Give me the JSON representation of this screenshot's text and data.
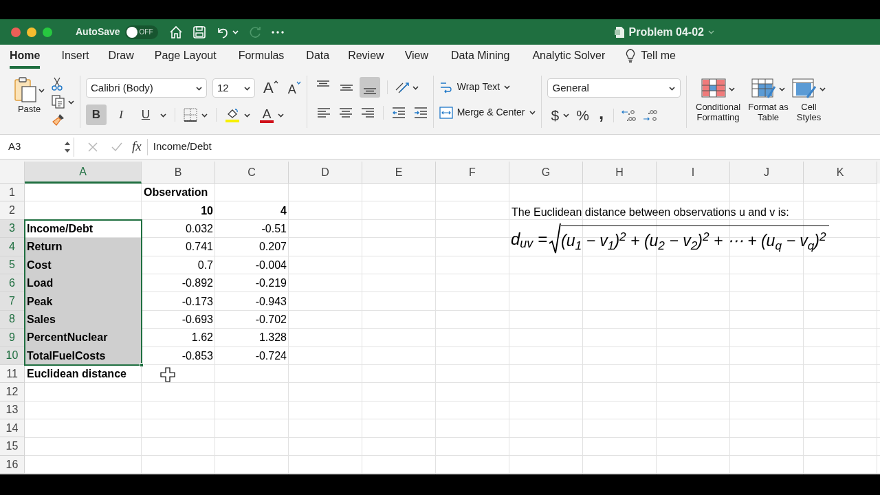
{
  "window": {
    "title": "Problem 04-02",
    "autosave": {
      "label": "AutoSave",
      "on": false,
      "state": "OFF"
    }
  },
  "ribbon_tabs": [
    {
      "label": "Home",
      "selected": true
    },
    {
      "label": "Insert",
      "selected": false
    },
    {
      "label": "Draw",
      "selected": false
    },
    {
      "label": "Page Layout",
      "selected": false
    },
    {
      "label": "Formulas",
      "selected": false
    },
    {
      "label": "Data",
      "selected": false
    },
    {
      "label": "Review",
      "selected": false
    },
    {
      "label": "View",
      "selected": false
    },
    {
      "label": "Data Mining",
      "selected": false
    },
    {
      "label": "Analytic Solver",
      "selected": false
    }
  ],
  "tell_me": "Tell me",
  "ribbon": {
    "paste": "Paste",
    "font_name": "Calibri (Body)",
    "font_size": "12",
    "grow_font": "A",
    "shrink_font": "A",
    "text_format": [
      {
        "label": "B",
        "selected": true
      },
      {
        "label": "I",
        "selected": false
      },
      {
        "label": "U",
        "selected": false
      }
    ],
    "font_color": "A",
    "vertical_align": [
      {
        "selected": false
      },
      {
        "selected": false
      },
      {
        "selected": true
      }
    ],
    "wrap_text": "Wrap Text",
    "merge_center": "Merge & Center",
    "number_format": "General",
    "currency": "$",
    "percent": "%",
    "comma": ",",
    "styles": [
      "Conditional Formatting",
      "Format as Table",
      "Cell Styles"
    ]
  },
  "formula_bar": {
    "name_box": "A3",
    "fx": "fx",
    "formula": "Income/Debt"
  },
  "sheet": {
    "columns": [
      {
        "label": "A",
        "selected": true
      },
      {
        "label": "B",
        "selected": false
      },
      {
        "label": "C",
        "selected": false
      },
      {
        "label": "D",
        "selected": false
      },
      {
        "label": "E",
        "selected": false
      },
      {
        "label": "F",
        "selected": false
      },
      {
        "label": "G",
        "selected": false
      },
      {
        "label": "H",
        "selected": false
      },
      {
        "label": "I",
        "selected": false
      },
      {
        "label": "J",
        "selected": false
      },
      {
        "label": "K",
        "selected": false
      }
    ],
    "rows": [
      {
        "header": "1",
        "selected": false,
        "cells": [
          null,
          {
            "text": "Observation",
            "kind": "text",
            "bold": true,
            "selected": false
          }
        ]
      },
      {
        "header": "2",
        "selected": false,
        "cells": [
          null,
          {
            "text": "10",
            "kind": "number",
            "bold": true,
            "selected": false
          },
          {
            "text": "4",
            "kind": "number",
            "bold": true,
            "selected": false
          }
        ]
      },
      {
        "header": "3",
        "selected": true,
        "cells": [
          {
            "text": "Income/Debt",
            "kind": "text",
            "bold": true,
            "selected": true
          },
          {
            "text": "0.032",
            "kind": "number",
            "bold": false,
            "selected": false
          },
          {
            "text": "-0.51",
            "kind": "number",
            "bold": false,
            "selected": false
          }
        ]
      },
      {
        "header": "4",
        "selected": true,
        "cells": [
          {
            "text": "Return",
            "kind": "text",
            "bold": true,
            "selected": true
          },
          {
            "text": "0.741",
            "kind": "number",
            "bold": false,
            "selected": false
          },
          {
            "text": "0.207",
            "kind": "number",
            "bold": false,
            "selected": false
          }
        ]
      },
      {
        "header": "5",
        "selected": true,
        "cells": [
          {
            "text": "Cost",
            "kind": "text",
            "bold": true,
            "selected": true
          },
          {
            "text": "0.7",
            "kind": "number",
            "bold": false,
            "selected": false
          },
          {
            "text": "-0.004",
            "kind": "number",
            "bold": false,
            "selected": false
          }
        ]
      },
      {
        "header": "6",
        "selected": true,
        "cells": [
          {
            "text": "Load",
            "kind": "text",
            "bold": true,
            "selected": true
          },
          {
            "text": "-0.892",
            "kind": "number",
            "bold": false,
            "selected": false
          },
          {
            "text": "-0.219",
            "kind": "number",
            "bold": false,
            "selected": false
          }
        ]
      },
      {
        "header": "7",
        "selected": true,
        "cells": [
          {
            "text": "Peak",
            "kind": "text",
            "bold": true,
            "selected": true
          },
          {
            "text": "-0.173",
            "kind": "number",
            "bold": false,
            "selected": false
          },
          {
            "text": "-0.943",
            "kind": "number",
            "bold": false,
            "selected": false
          }
        ]
      },
      {
        "header": "8",
        "selected": true,
        "cells": [
          {
            "text": "Sales",
            "kind": "text",
            "bold": true,
            "selected": true
          },
          {
            "text": "-0.693",
            "kind": "number",
            "bold": false,
            "selected": false
          },
          {
            "text": "-0.702",
            "kind": "number",
            "bold": false,
            "selected": false
          }
        ]
      },
      {
        "header": "9",
        "selected": true,
        "cells": [
          {
            "text": "PercentNuclear",
            "kind": "text",
            "bold": true,
            "selected": true
          },
          {
            "text": "1.62",
            "kind": "number",
            "bold": false,
            "selected": false
          },
          {
            "text": "1.328",
            "kind": "number",
            "bold": false,
            "selected": false
          }
        ]
      },
      {
        "header": "10",
        "selected": true,
        "cells": [
          {
            "text": "TotalFuelCosts",
            "kind": "text",
            "bold": true,
            "selected": true
          },
          {
            "text": "-0.853",
            "kind": "number",
            "bold": false,
            "selected": false
          },
          {
            "text": "-0.724",
            "kind": "number",
            "bold": false,
            "selected": false
          }
        ]
      },
      {
        "header": "11",
        "selected": false,
        "cells": [
          {
            "text": "Euclidean distance",
            "kind": "text",
            "bold": true,
            "selected": false
          }
        ]
      },
      {
        "header": "12",
        "selected": false,
        "cells": []
      },
      {
        "header": "13",
        "selected": false,
        "cells": []
      },
      {
        "header": "14",
        "selected": false,
        "cells": []
      },
      {
        "header": "15",
        "selected": false,
        "cells": []
      },
      {
        "header": "16",
        "selected": false,
        "cells": []
      }
    ],
    "note": "The Euclidean distance between observations u and v is:",
    "equation": {
      "lhs": "d$_{uv}$ =",
      "radicand": "(u$_{1}$ − v$_{1}$)$^{2}$ + (u$_{2}$ − v$_{2}$)$^{2}$ + ⋯ + (u$_{q}$ − v$_{q}$)$^{2}$"
    }
  }
}
